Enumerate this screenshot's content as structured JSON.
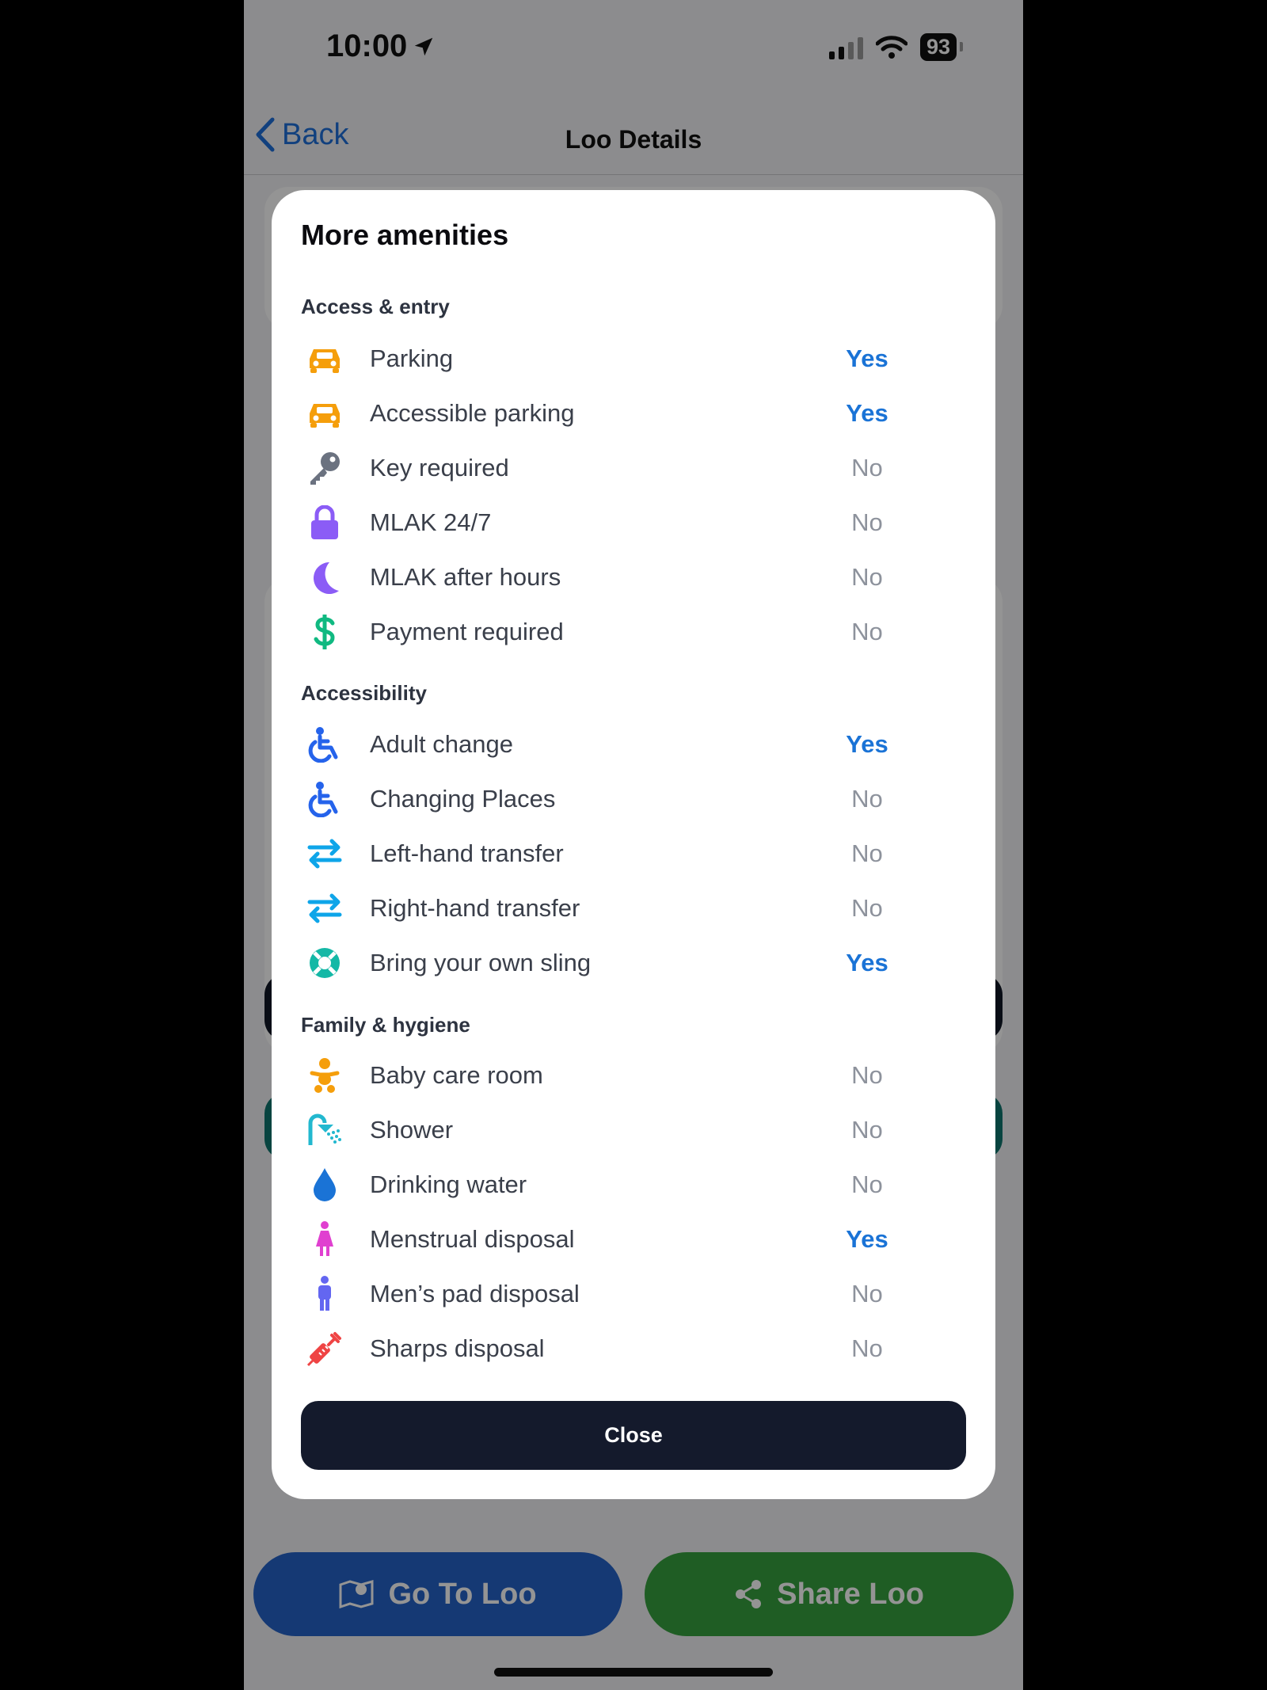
{
  "status_bar": {
    "time": "10:00",
    "battery": "93"
  },
  "nav": {
    "back_label": "Back",
    "title": "Loo Details"
  },
  "modal": {
    "title": "More amenities",
    "sections": [
      {
        "heading": "Access & entry",
        "items": [
          {
            "label": "Parking",
            "value": "Yes",
            "icon": "car-icon",
            "color": "#f59e0b"
          },
          {
            "label": "Accessible parking",
            "value": "Yes",
            "icon": "car-icon",
            "color": "#f59e0b"
          },
          {
            "label": "Key required",
            "value": "No",
            "icon": "key-icon",
            "color": "#6b7280"
          },
          {
            "label": "MLAK 24/7",
            "value": "No",
            "icon": "lock-icon",
            "color": "#8b5cf6"
          },
          {
            "label": "MLAK after hours",
            "value": "No",
            "icon": "moon-icon",
            "color": "#8b5cf6"
          },
          {
            "label": "Payment required",
            "value": "No",
            "icon": "dollar-icon",
            "color": "#10b981"
          }
        ]
      },
      {
        "heading": "Accessibility",
        "items": [
          {
            "label": "Adult change",
            "value": "Yes",
            "icon": "wheelchair-icon",
            "color": "#2563eb"
          },
          {
            "label": "Changing Places",
            "value": "No",
            "icon": "wheelchair-icon",
            "color": "#2563eb"
          },
          {
            "label": "Left-hand transfer",
            "value": "No",
            "icon": "transfer-arrows-icon",
            "color": "#0ea5e9"
          },
          {
            "label": "Right-hand transfer",
            "value": "No",
            "icon": "transfer-arrows-icon",
            "color": "#0ea5e9"
          },
          {
            "label": "Bring your own sling",
            "value": "Yes",
            "icon": "lifebuoy-icon",
            "color": "#14b8a6"
          }
        ]
      },
      {
        "heading": "Family & hygiene",
        "items": [
          {
            "label": "Baby care room",
            "value": "No",
            "icon": "baby-icon",
            "color": "#f59e0b"
          },
          {
            "label": "Shower",
            "value": "No",
            "icon": "shower-icon",
            "color": "#22b8cf"
          },
          {
            "label": "Drinking water",
            "value": "No",
            "icon": "water-drop-icon",
            "color": "#1a73d6"
          },
          {
            "label": "Menstrual disposal",
            "value": "Yes",
            "icon": "female-icon",
            "color": "#e040d0"
          },
          {
            "label": "Men’s pad disposal",
            "value": "No",
            "icon": "male-icon",
            "color": "#6366f1"
          },
          {
            "label": "Sharps disposal",
            "value": "No",
            "icon": "syringe-icon",
            "color": "#ef4444"
          }
        ]
      }
    ],
    "close_label": "Close"
  },
  "bottom_actions": {
    "go_label": "Go To Loo",
    "share_label": "Share Loo"
  },
  "colors": {
    "yes": "#1a73d6",
    "no": "#8d929c",
    "go": "#2563c9",
    "share": "#36a13f",
    "close_bg": "#141a2c"
  }
}
